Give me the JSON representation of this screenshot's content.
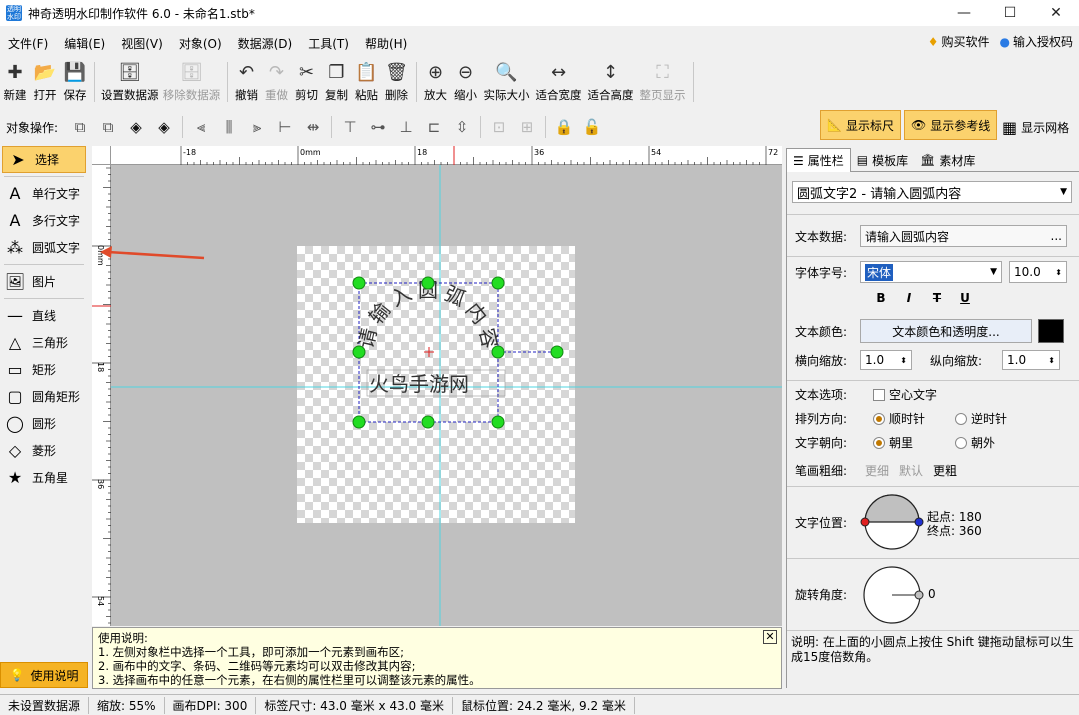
{
  "window": {
    "title": "神奇透明水印制作软件 6.0 - 未命名1.stb*",
    "app_icon_text": "透明水印"
  },
  "menu": [
    "文件(F)",
    "编辑(E)",
    "视图(V)",
    "对象(O)",
    "数据源(D)",
    "工具(T)",
    "帮助(H)"
  ],
  "menu_right": {
    "buy": "购买软件",
    "license": "输入授权码"
  },
  "toolbar": [
    {
      "name": "new",
      "label": "新建",
      "icon": "✚",
      "disabled": false
    },
    {
      "name": "open",
      "label": "打开",
      "icon": "📂",
      "disabled": false
    },
    {
      "name": "save",
      "label": "保存",
      "icon": "💾",
      "disabled": false
    },
    {
      "name": "set-datasource",
      "label": "设置数据源",
      "icon": "🗄",
      "disabled": false
    },
    {
      "name": "remove-datasource",
      "label": "移除数据源",
      "icon": "🗄",
      "disabled": true
    },
    {
      "name": "undo",
      "label": "撤销",
      "icon": "↶",
      "disabled": false
    },
    {
      "name": "redo",
      "label": "重做",
      "icon": "↷",
      "disabled": true
    },
    {
      "name": "cut",
      "label": "剪切",
      "icon": "✂",
      "disabled": false
    },
    {
      "name": "copy",
      "label": "复制",
      "icon": "❐",
      "disabled": false
    },
    {
      "name": "paste",
      "label": "粘贴",
      "icon": "📋",
      "disabled": false
    },
    {
      "name": "delete",
      "label": "删除",
      "icon": "🗑",
      "disabled": false
    },
    {
      "name": "zoom-in",
      "label": "放大",
      "icon": "⊕",
      "disabled": false
    },
    {
      "name": "zoom-out",
      "label": "缩小",
      "icon": "⊖",
      "disabled": false
    },
    {
      "name": "actual-size",
      "label": "实际大小",
      "icon": "🔍",
      "disabled": false
    },
    {
      "name": "fit-width",
      "label": "适合宽度",
      "icon": "↔",
      "disabled": false
    },
    {
      "name": "fit-height",
      "label": "适合高度",
      "icon": "↕",
      "disabled": false
    },
    {
      "name": "full-page",
      "label": "整页显示",
      "icon": "⛶",
      "disabled": true
    }
  ],
  "objbar": {
    "label": "对象操作:",
    "show_ruler": "显示标尺",
    "show_guides": "显示参考线",
    "show_grid": "显示网格"
  },
  "lefttools": [
    {
      "name": "select",
      "label": "选择",
      "icon": "➤",
      "selected": true
    },
    {
      "name": "single-line-text",
      "label": "单行文字",
      "icon": "A",
      "selected": false
    },
    {
      "name": "multi-line-text",
      "label": "多行文字",
      "icon": "A",
      "selected": false
    },
    {
      "name": "arc-text",
      "label": "圆弧文字",
      "icon": "⁂",
      "selected": false
    },
    {
      "name": "image",
      "label": "图片",
      "icon": "🖼",
      "selected": false
    },
    {
      "name": "line",
      "label": "直线",
      "icon": "—",
      "selected": false
    },
    {
      "name": "triangle",
      "label": "三角形",
      "icon": "△",
      "selected": false
    },
    {
      "name": "rectangle",
      "label": "矩形",
      "icon": "▭",
      "selected": false
    },
    {
      "name": "rounded-rect",
      "label": "圆角矩形",
      "icon": "▢",
      "selected": false
    },
    {
      "name": "circle",
      "label": "圆形",
      "icon": "◯",
      "selected": false
    },
    {
      "name": "diamond",
      "label": "菱形",
      "icon": "◇",
      "selected": false
    },
    {
      "name": "star",
      "label": "五角星",
      "icon": "★",
      "selected": false
    }
  ],
  "help_button": "使用说明",
  "ruler": {
    "h_ticks": [
      "-18",
      "0mm",
      "18",
      "36",
      "54",
      "72"
    ],
    "v_ticks": [
      "0mm",
      "18",
      "36",
      "54"
    ]
  },
  "canvas": {
    "arc_text_chars": [
      "请",
      "输",
      "入",
      "圆",
      "弧",
      "内",
      "容"
    ],
    "watermark_text": "火鸟手游网"
  },
  "helpbox": {
    "title": "使用说明:",
    "lines": [
      "1. 左侧对象栏中选择一个工具，即可添加一个元素到画布区;",
      "2. 画布中的文字、条码、二维码等元素均可以双击修改其内容;",
      "3. 选择画布中的任意一个元素，在右侧的属性栏里可以调整该元素的属性。"
    ]
  },
  "tabs": [
    "属性栏",
    "模板库",
    "素材库"
  ],
  "props": {
    "object_select": "圆弧文字2 - 请输入圆弧内容",
    "text_data_label": "文本数据:",
    "text_data_value": "请输入圆弧内容",
    "font_label": "字体字号:",
    "font_value": "宋体",
    "font_size": "10.0",
    "text_color_label": "文本颜色:",
    "text_color_button": "文本颜色和透明度...",
    "text_color": "#000000",
    "hscale_label": "横向缩放:",
    "hscale_value": "1.0",
    "vscale_label": "纵向缩放:",
    "vscale_value": "1.0",
    "text_options_label": "文本选项:",
    "hollow_label": "空心文字",
    "direction_label": "排列方向:",
    "clockwise": "顺时针",
    "counterclockwise": "逆时针",
    "facing_label": "文字朝向:",
    "inward": "朝里",
    "outward": "朝外",
    "stroke_label": "笔画粗细:",
    "stroke_options": [
      "更细",
      "默认",
      "更粗"
    ],
    "position_label": "文字位置:",
    "start_label": "起点:",
    "start_value": "180",
    "end_label": "终点:",
    "end_value": "360",
    "rotation_label": "旋转角度:",
    "rotation_value": "0",
    "note": "说明: 在上面的小圆点上按住 Shift 键拖动鼠标可以生成15度倍数角。"
  },
  "status": [
    "未设置数据源",
    "缩放: 55%",
    "画布DPI: 300",
    "标签尺寸: 43.0 毫米 x 43.0 毫米",
    "鼠标位置: 24.2 毫米, 9.2 毫米"
  ]
}
